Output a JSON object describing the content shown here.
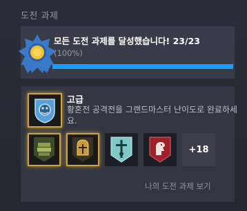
{
  "section": {
    "title": "도전 과제"
  },
  "summary": {
    "text": "모든 도전 과제를 달성했습니다! 23/23",
    "percent_label": "(100%)",
    "progress": 1.0
  },
  "featured": {
    "title": "고급",
    "description": "황혼전 공격전을 그랜드마스터 난이도로 완료하세요.",
    "icon": "blue-crest-shield-icon"
  },
  "badges": [
    {
      "icon": "green-armor-plates-icon",
      "frame": "gold"
    },
    {
      "icon": "gold-knight-helmet-icon",
      "frame": "gold"
    },
    {
      "icon": "teal-sword-shield-icon",
      "frame": "plain"
    },
    {
      "icon": "red-lion-shield-icon",
      "frame": "plain"
    }
  ],
  "more_count_label": "+18",
  "link": {
    "view_my_achievements": "나의 도전 과제 보기"
  },
  "colors": {
    "progress": "#1a9fff",
    "gold_frame": "#d1a43a",
    "background": "#212530"
  }
}
